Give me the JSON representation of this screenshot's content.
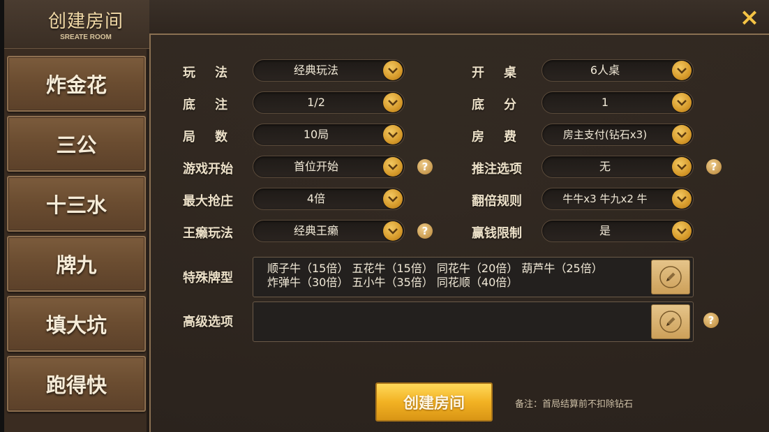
{
  "header": {
    "title": "创建房间",
    "subtitle": "SREATE ROOM",
    "close_icon": "×"
  },
  "sidebar": {
    "items": [
      {
        "label": "炸金花"
      },
      {
        "label": "三公"
      },
      {
        "label": "十三水"
      },
      {
        "label": "牌九"
      },
      {
        "label": "填大坑"
      },
      {
        "label": "跑得快"
      }
    ]
  },
  "form": {
    "play_mode": {
      "label": "玩法",
      "value": "经典玩法"
    },
    "table_size": {
      "label": "开桌",
      "value": "6人桌"
    },
    "base_bet": {
      "label": "底注",
      "value": "1/2"
    },
    "base_score": {
      "label": "底分",
      "value": "1"
    },
    "rounds": {
      "label": "局数",
      "value": "10局"
    },
    "room_fee": {
      "label": "房费",
      "value": "房主支付(钻石x3)"
    },
    "game_start": {
      "label": "游戏开始",
      "value": "首位开始"
    },
    "push_bet": {
      "label": "推注选项",
      "value": "无"
    },
    "max_banker": {
      "label": "最大抢庄",
      "value": "4倍"
    },
    "double_rule": {
      "label": "翻倍规则",
      "value": "牛牛x3 牛九x2 牛"
    },
    "wildcard": {
      "label": "王癞玩法",
      "value": "经典王癞"
    },
    "win_limit": {
      "label": "赢钱限制",
      "value": "是"
    },
    "special_hands": {
      "label": "特殊牌型",
      "line1": "顺子牛（15倍） 五花牛（15倍） 同花牛（20倍） 葫芦牛（25倍）",
      "line2": "炸弹牛（30倍） 五小牛（35倍） 同花顺（40倍）"
    },
    "advanced": {
      "label": "高级选项",
      "value": ""
    }
  },
  "footer": {
    "create_label": "创建房间",
    "note": "备注：首局结算前不扣除钻石"
  },
  "help_icon": "?",
  "colors": {
    "accent": "#f5c445",
    "button": "#f2b223",
    "wood": "#6a4c30"
  }
}
